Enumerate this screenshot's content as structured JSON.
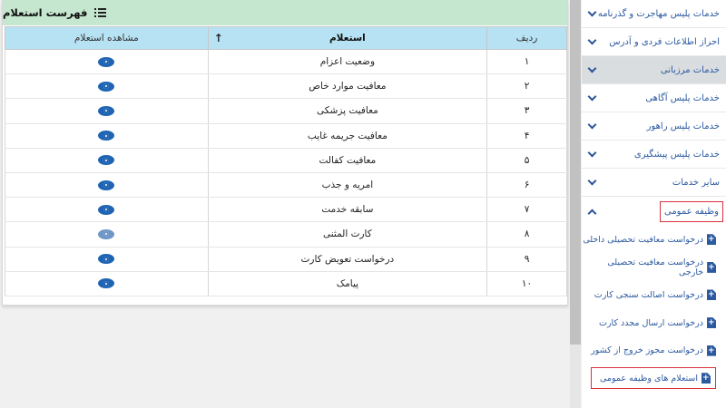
{
  "panel": {
    "title": "فهرست استعلام",
    "columns": {
      "row": "ردیف",
      "inquiry": "استعلام",
      "view": "مشاهده استعلام"
    },
    "rows": [
      {
        "num": "۱",
        "name": "وضعیت اعزام"
      },
      {
        "num": "۲",
        "name": "معافیت موارد خاص"
      },
      {
        "num": "۳",
        "name": "معافیت پزشکی"
      },
      {
        "num": "۴",
        "name": "معافیت جریمه غایب"
      },
      {
        "num": "۵",
        "name": "معافیت کفالت"
      },
      {
        "num": "۶",
        "name": "امریه و جذب"
      },
      {
        "num": "۷",
        "name": "سابقه خدمت"
      },
      {
        "num": "۸",
        "name": "کارت المثنی"
      },
      {
        "num": "۹",
        "name": "درخواست تعویض کارت"
      },
      {
        "num": "۱۰",
        "name": "پیامک"
      }
    ]
  },
  "sidebar": {
    "items": [
      {
        "label": "خدمات پلیس مهاجرت و گذرنامه"
      },
      {
        "label": "احراز اطلاعات فردی و آدرس"
      },
      {
        "label": "خدمات مرزبانی"
      },
      {
        "label": "خدمات پلیس آگاهی"
      },
      {
        "label": "خدمات پلیس راهور"
      },
      {
        "label": "خدمات پلیس پیشگیری"
      },
      {
        "label": "سایر خدمات"
      }
    ],
    "open_section": "وظیفه عمومی",
    "sub_items": [
      {
        "label": "درخواست معافیت تحصیلی داخلی"
      },
      {
        "label": "درخواست معافیت تحصیلی خارجی"
      },
      {
        "label": "درخواست اصالت سنجی کارت"
      },
      {
        "label": "درخواست ارسال مجدد کارت"
      },
      {
        "label": "درخواست مجوز خروج از کشور"
      },
      {
        "label": "استعلام های وظیفه عمومی"
      }
    ]
  }
}
